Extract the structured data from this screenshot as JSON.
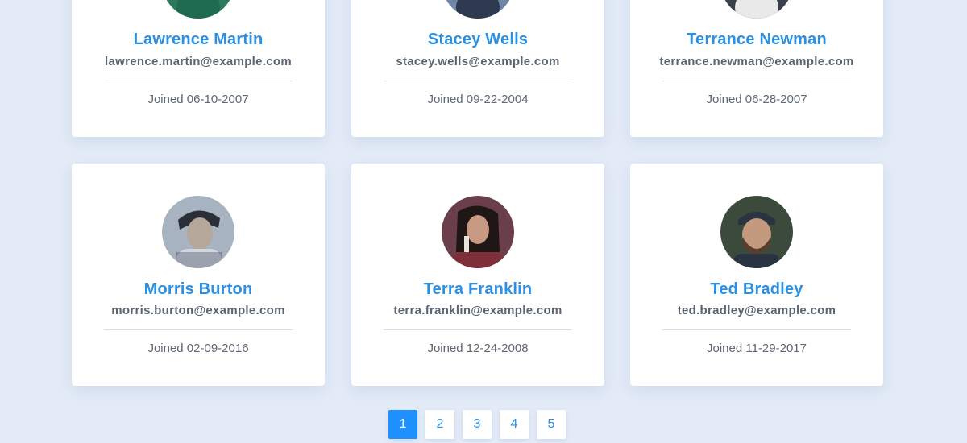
{
  "users": [
    {
      "name": "Lawrence Martin",
      "email": "lawrence.martin@example.com",
      "joined": "Joined 06-10-2007"
    },
    {
      "name": "Stacey Wells",
      "email": "stacey.wells@example.com",
      "joined": "Joined 09-22-2004"
    },
    {
      "name": "Terrance Newman",
      "email": "terrance.newman@example.com",
      "joined": "Joined 06-28-2007"
    },
    {
      "name": "Morris Burton",
      "email": "morris.burton@example.com",
      "joined": "Joined 02-09-2016"
    },
    {
      "name": "Terra Franklin",
      "email": "terra.franklin@example.com",
      "joined": "Joined 12-24-2008"
    },
    {
      "name": "Ted Bradley",
      "email": "ted.bradley@example.com",
      "joined": "Joined 11-29-2017"
    }
  ],
  "pagination": {
    "pages": [
      "1",
      "2",
      "3",
      "4",
      "5"
    ],
    "current": "1"
  },
  "colors": {
    "background": "#e3ebf7",
    "accent": "#2b8fe3",
    "active_page": "#1e90ff"
  }
}
